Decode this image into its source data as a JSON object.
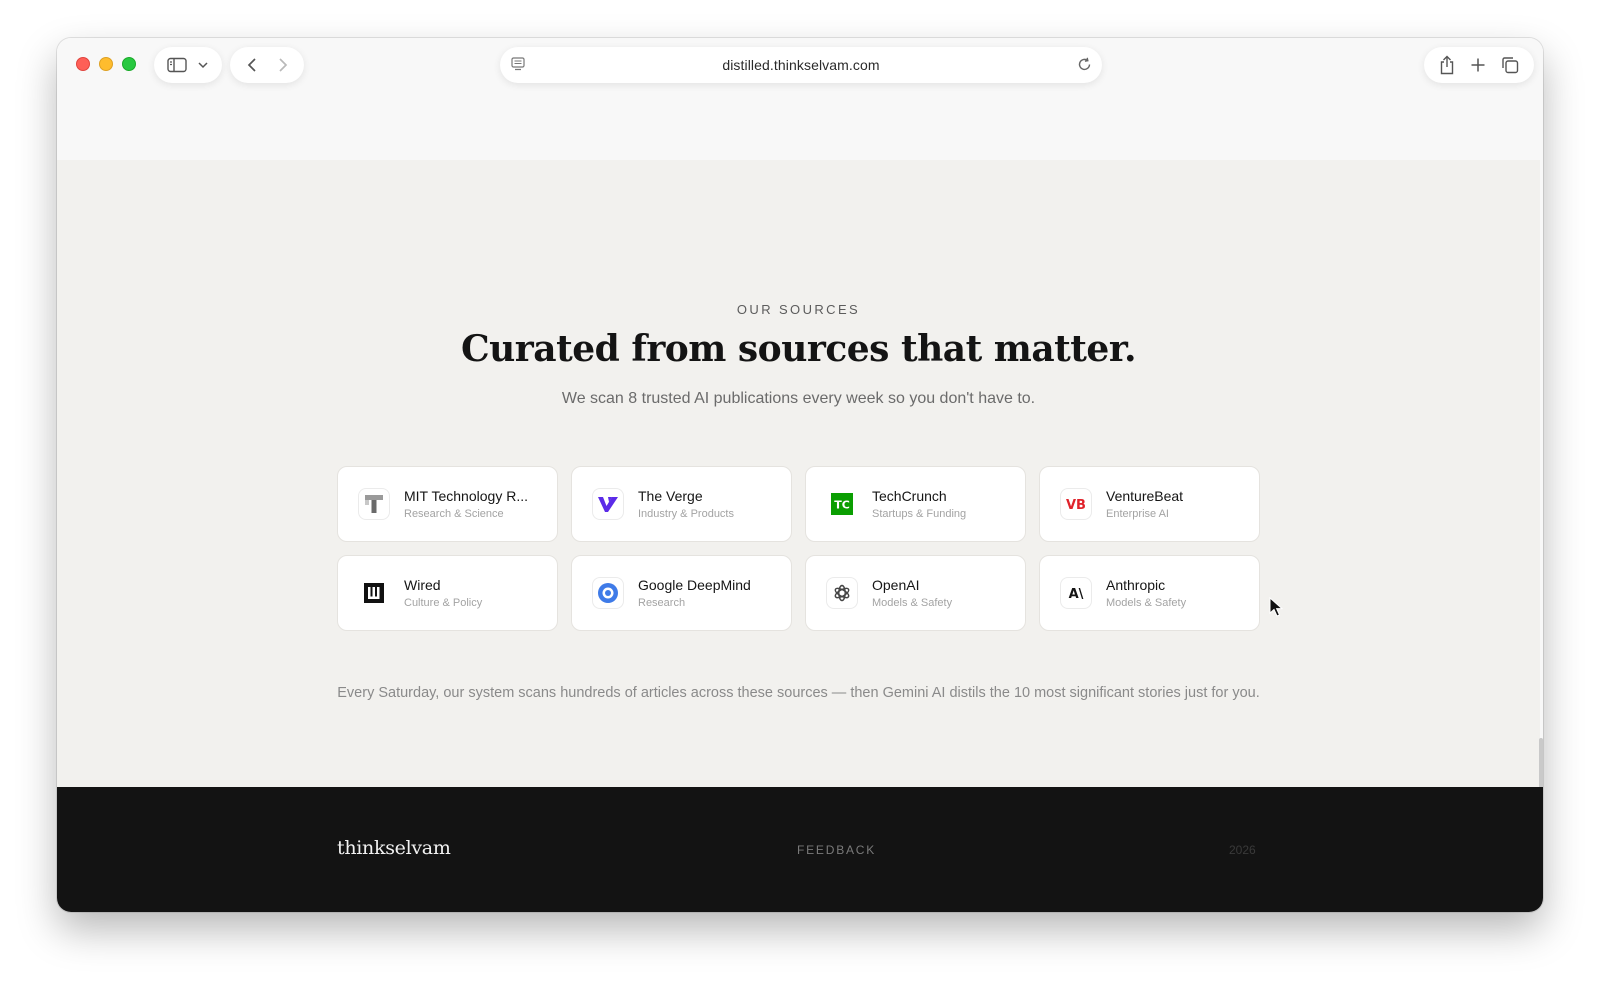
{
  "browser": {
    "url": "distilled.thinkselvam.com",
    "icons": {
      "sidebar": "sidebar-icon",
      "chevron": "chevron-down-icon",
      "back": "back-arrow-icon",
      "forward": "forward-arrow-icon",
      "page_menu": "page-menu-icon",
      "reload": "reload-icon",
      "share": "share-icon",
      "new_tab": "plus-icon",
      "tabs": "tab-overview-icon"
    }
  },
  "sources_section": {
    "eyebrow": "OUR SOURCES",
    "headline": "Curated from sources that matter.",
    "subhead": "We scan 8 trusted AI publications every week so you don't have to.",
    "sources": [
      {
        "name": "MIT Technology R...",
        "category": "Research & Science",
        "logo": "mit-technology-review-logo"
      },
      {
        "name": "The Verge",
        "category": "Industry & Products",
        "logo": "the-verge-logo"
      },
      {
        "name": "TechCrunch",
        "category": "Startups & Funding",
        "logo": "techcrunch-logo"
      },
      {
        "name": "VentureBeat",
        "category": "Enterprise AI",
        "logo": "venturebeat-logo"
      },
      {
        "name": "Wired",
        "category": "Culture & Policy",
        "logo": "wired-logo"
      },
      {
        "name": "Google DeepMind",
        "category": "Research",
        "logo": "google-deepmind-logo"
      },
      {
        "name": "OpenAI",
        "category": "Models & Safety",
        "logo": "openai-logo"
      },
      {
        "name": "Anthropic",
        "category": "Models & Safety",
        "logo": "anthropic-logo"
      }
    ],
    "logo_text": {
      "techcrunch": "TC",
      "venturebeat": "VB",
      "anthropic": "A\\"
    },
    "note": "Every Saturday, our system scans hundreds of articles across these sources — then Gemini AI distils the 10 most significant stories just for you."
  },
  "footer": {
    "brand": "thinkselvam",
    "feedback": "FEEDBACK",
    "year": "2026"
  },
  "colors": {
    "section_bg": "#f2f1ee",
    "footer_bg": "#131313",
    "verge_purple": "#5b2be8",
    "techcrunch_green": "#0a9e01",
    "venturebeat_red": "#e0232b",
    "deepmind_blue": "#3f7be8"
  }
}
